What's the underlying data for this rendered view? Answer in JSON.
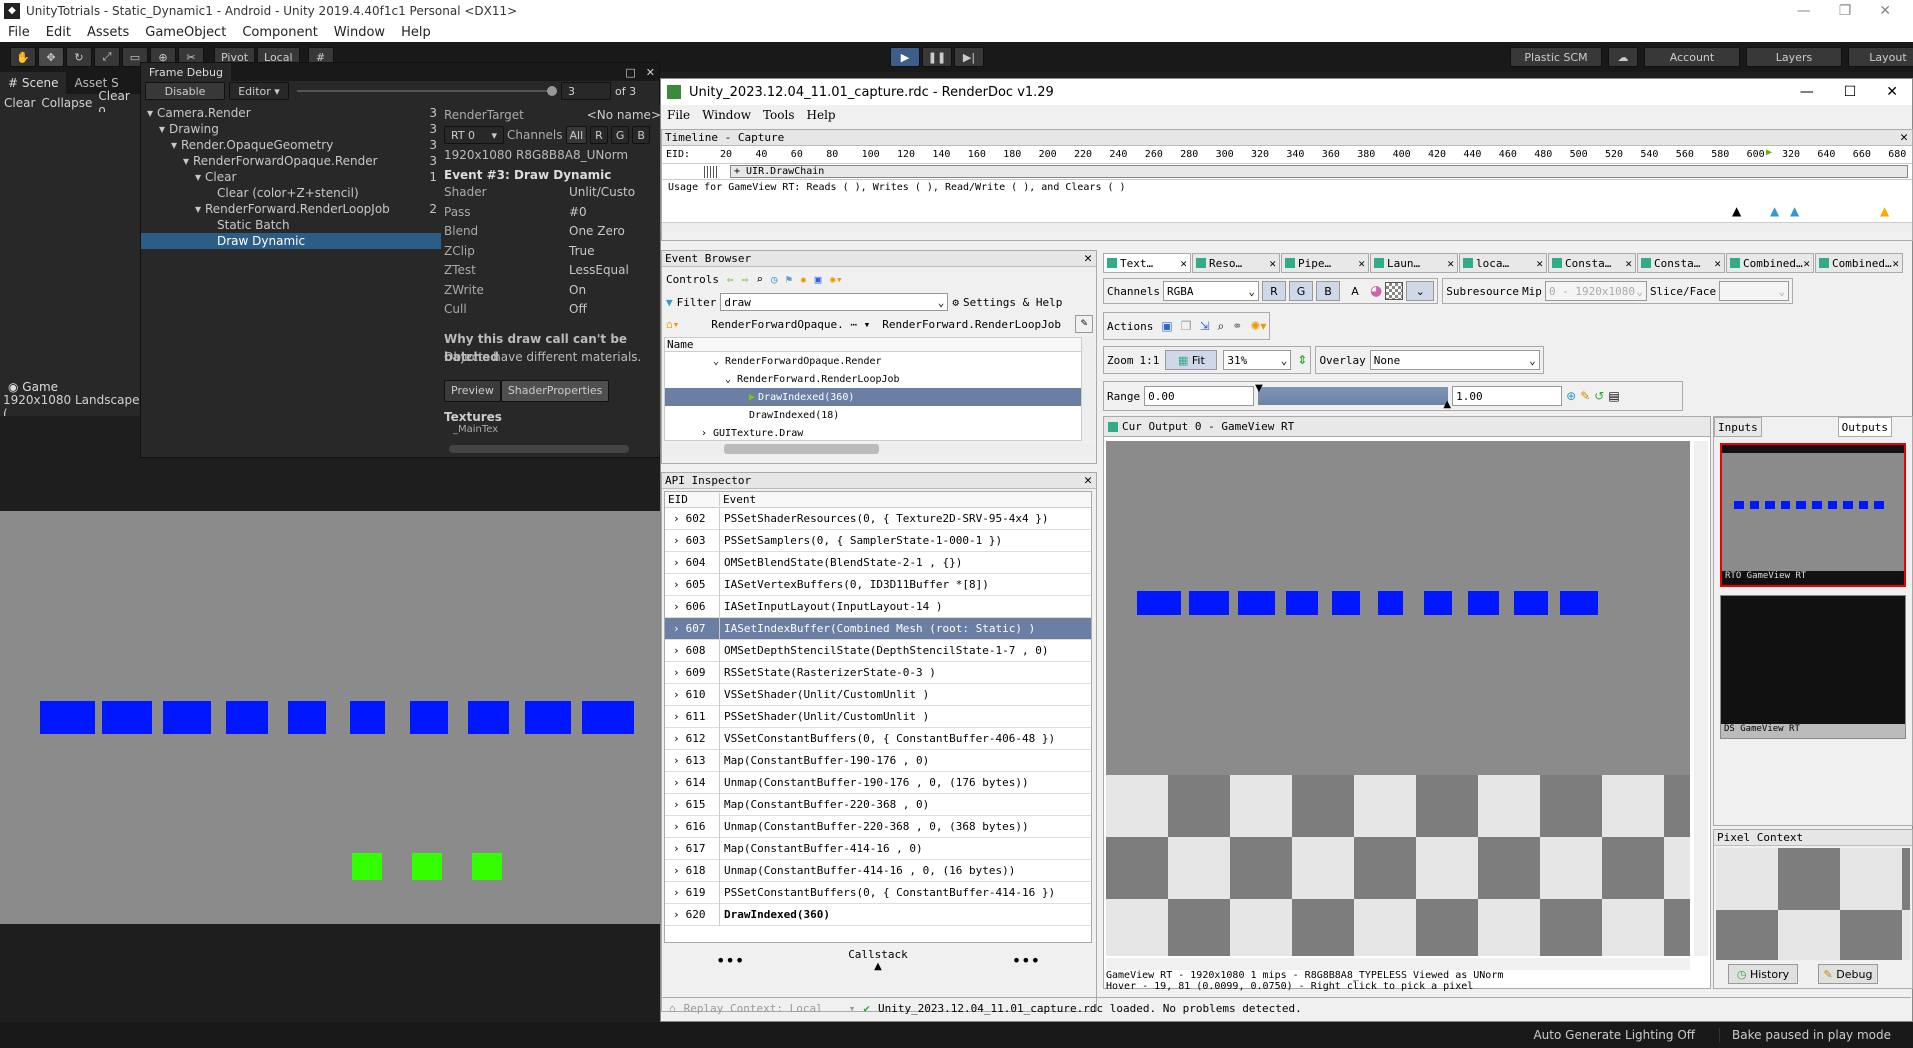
{
  "unity": {
    "title": "UnityTotrials - Static_Dynamic1 - Android - Unity 2019.4.40f1c1 Personal <DX11>",
    "menu": [
      "File",
      "Edit",
      "Assets",
      "GameObject",
      "Component",
      "Window",
      "Help"
    ],
    "toolbar": {
      "pivot": "Pivot",
      "local": "Local",
      "plastic": "Plastic SCM",
      "account": "Account",
      "layers": "Layers",
      "layout": "Layout"
    },
    "scene_tabs": {
      "scene": "Scene",
      "asset": "Asset S"
    },
    "console_btns": [
      "Clear",
      "Collapse",
      "Clear o"
    ],
    "game_tab": "Game",
    "game_res": "1920x1080 Landscape (",
    "status": {
      "lighting": "Auto Generate Lighting Off",
      "bake": "Bake paused in play mode"
    }
  },
  "frame_debug": {
    "tab": "Frame Debug",
    "disable": "Disable",
    "editor": "Editor",
    "step": "3",
    "of": "of 3",
    "tree": [
      {
        "label": "Camera.Render",
        "count": "3",
        "indent": 0,
        "caret": "▾"
      },
      {
        "label": "Drawing",
        "count": "3",
        "indent": 1,
        "caret": "▾"
      },
      {
        "label": "Render.OpaqueGeometry",
        "count": "3",
        "indent": 2,
        "caret": "▾"
      },
      {
        "label": "RenderForwardOpaque.Render",
        "count": "3",
        "indent": 3,
        "caret": "▾"
      },
      {
        "label": "Clear",
        "count": "1",
        "indent": 4,
        "caret": "▾"
      },
      {
        "label": "Clear (color+Z+stencil)",
        "count": "",
        "indent": 5,
        "caret": ""
      },
      {
        "label": "RenderForward.RenderLoopJob",
        "count": "2",
        "indent": 4,
        "caret": "▾"
      },
      {
        "label": "Static Batch",
        "count": "",
        "indent": 5,
        "caret": ""
      },
      {
        "label": "Draw Dynamic",
        "count": "",
        "indent": 5,
        "caret": "",
        "sel": true
      }
    ],
    "rt_label": "RenderTarget",
    "rt_value": "<No name>",
    "rt_select": "RT 0",
    "channels": "Channels",
    "ch_btns": [
      "All",
      "R",
      "G",
      "B"
    ],
    "format": "1920x1080 R8G8B8A8_UNorm",
    "event": "Event #3: Draw Dynamic",
    "props": [
      {
        "k": "Shader",
        "v": "Unlit/Custo"
      },
      {
        "k": "Pass",
        "v": "#0"
      },
      {
        "k": "Blend",
        "v": "One Zero"
      },
      {
        "k": "ZClip",
        "v": "True"
      },
      {
        "k": "ZTest",
        "v": "LessEqual"
      },
      {
        "k": "ZWrite",
        "v": "On"
      },
      {
        "k": "Cull",
        "v": "Off"
      }
    ],
    "why": "Why this draw call can't be batched",
    "reason": "Objects have different materials.",
    "tabs": [
      "Preview",
      "ShaderProperties"
    ],
    "textures": "Textures",
    "maintex": "_MainTex"
  },
  "rd": {
    "title": "Unity_2023.12.04_11.01_capture.rdc - RenderDoc v1.29",
    "menu": [
      "File",
      "Window",
      "Tools",
      "Help"
    ],
    "timeline": {
      "header": "Timeline - Capture",
      "eid": "EID:",
      "ticks": [
        "20",
        "40",
        "60",
        "80",
        "100",
        "120",
        "140",
        "160",
        "180",
        "200",
        "220",
        "240",
        "260",
        "280",
        "300",
        "320",
        "340",
        "360",
        "380",
        "400",
        "420",
        "440",
        "460",
        "480",
        "500",
        "520",
        "540",
        "560",
        "580",
        "600",
        "320",
        "640",
        "660",
        "680"
      ],
      "chain": "+ UIR.DrawChain",
      "usage": "Usage for GameView RT: Reads (  ), Writes (  ), Read/Write (  ), and Clears (  )"
    },
    "event_browser": {
      "header": "Event Browser",
      "controls": "Controls",
      "filter": "Filter",
      "filter_value": "draw",
      "settings": "Settings & Help",
      "crumb1": "RenderForwardOpaque.",
      "crumb2": "RenderForward.RenderLoopJob",
      "col": "Name",
      "rows": [
        {
          "t": "RenderForwardOpaque.Render",
          "i": 1,
          "caret": "⌄"
        },
        {
          "t": "RenderForward.RenderLoopJob",
          "i": 2,
          "caret": "⌄"
        },
        {
          "t": "DrawIndexed(360)",
          "i": 3,
          "caret": "",
          "sel": true
        },
        {
          "t": "DrawIndexed(18)",
          "i": 3,
          "caret": ""
        },
        {
          "t": "GUITexture.Draw",
          "i": 0,
          "caret": "›"
        }
      ]
    },
    "api": {
      "header": "API Inspector",
      "col_eid": "EID",
      "col_event": "Event",
      "rows": [
        {
          "eid": "602",
          "text": "PSSetShaderResources(0,  {  Texture2D-SRV-95-4x4  })"
        },
        {
          "eid": "603",
          "text": "PSSetSamplers(0,  {  SamplerState-1-000-1  })"
        },
        {
          "eid": "604",
          "text": "OMSetBlendState(BlendState-2-1 ,  {})"
        },
        {
          "eid": "605",
          "text": "IASetVertexBuffers(0, ID3D11Buffer *[8])"
        },
        {
          "eid": "606",
          "text": "IASetInputLayout(InputLayout-14 )"
        },
        {
          "eid": "607",
          "text": "IASetIndexBuffer(Combined Mesh (root: Static) )",
          "sel": true
        },
        {
          "eid": "608",
          "text": "OMSetDepthStencilState(DepthStencilState-1-7 ,  0)"
        },
        {
          "eid": "609",
          "text": "RSSetState(RasterizerState-0-3 )"
        },
        {
          "eid": "610",
          "text": "VSSetShader(Unlit/CustomUnlit )"
        },
        {
          "eid": "611",
          "text": "PSSetShader(Unlit/CustomUnlit )"
        },
        {
          "eid": "612",
          "text": "VSSetConstantBuffers(0,  {  ConstantBuffer-406-48  })"
        },
        {
          "eid": "613",
          "text": "Map(ConstantBuffer-190-176 ,  0)"
        },
        {
          "eid": "614",
          "text": "Unmap(ConstantBuffer-190-176 ,  0,  (176 bytes))"
        },
        {
          "eid": "615",
          "text": "Map(ConstantBuffer-220-368 ,  0)"
        },
        {
          "eid": "616",
          "text": "Unmap(ConstantBuffer-220-368 ,  0,  (368 bytes))"
        },
        {
          "eid": "617",
          "text": "Map(ConstantBuffer-414-16 ,  0)"
        },
        {
          "eid": "618",
          "text": "Unmap(ConstantBuffer-414-16 ,  0,  (16 bytes))"
        },
        {
          "eid": "619",
          "text": "PSSetConstantBuffers(0,  {  ConstantBuffer-414-16  })"
        },
        {
          "eid": "620",
          "text": "DrawIndexed(360)",
          "bold": true
        }
      ],
      "callstack": "Callstack"
    },
    "tex_tabs": [
      "Text…",
      "Reso…",
      "Pipe…",
      "Laun…",
      "loca…",
      "Consta…",
      "Consta…",
      "Combined…",
      "Combined…"
    ],
    "texviewer": {
      "channels": "Channels",
      "channels_val": "RGBA",
      "rgba": [
        "R",
        "G",
        "B",
        "A"
      ],
      "subresource": "Subresource",
      "mip": "Mip",
      "mip_val": "0 - 1920x1080",
      "slice": "Slice/Face",
      "actions": "Actions",
      "zoom": "Zoom",
      "one": "1:1",
      "fit": "Fit",
      "zoom_val": "31%",
      "overlay": "Overlay",
      "overlay_val": "None",
      "range": "Range",
      "range_min": "0.00",
      "range_max": "1.00",
      "cur_output": "Cur Output 0 - GameView RT",
      "info1": "GameView RT - 1920x1080 1 mips - R8G8B8A8_TYPELESS Viewed as UNorm",
      "info2": "Hover -    19,   81 (0.0099, 0.0750)  - Right click to pick a pixel",
      "inputs": "Inputs",
      "outputs": "Outputs",
      "thumb1": "RTO        GameView RT",
      "thumb2": "DS         GameView RT",
      "pixel_ctx": "Pixel Context",
      "history": "History",
      "debug": "Debug"
    },
    "status": "Replay Context: Local",
    "loaded": "Unity_2023.12.04_11.01_capture.rdc loaded. No problems detected."
  },
  "colors": {
    "unity_bg": "#282828",
    "gameview": "#8b8b8b",
    "blue": "#0016ff",
    "green": "#33ff00",
    "selected": "#2c5d87"
  }
}
